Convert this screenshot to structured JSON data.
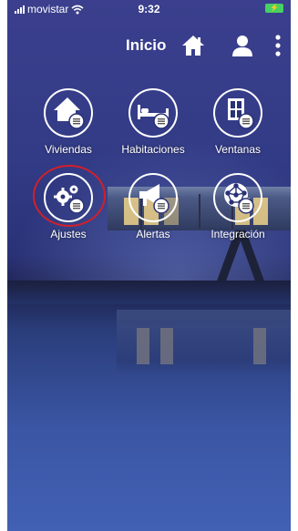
{
  "status_bar": {
    "carrier": "movistar",
    "time": "9:32",
    "battery_color": "#46d161"
  },
  "header": {
    "title": "Inicio",
    "icons": [
      "home-icon",
      "user-icon",
      "more-vertical-icon"
    ]
  },
  "tiles": [
    {
      "label": "Viviendas",
      "icon": "house-list-icon"
    },
    {
      "label": "Habitaciones",
      "icon": "bed-list-icon"
    },
    {
      "label": "Ventanas",
      "icon": "window-list-icon"
    },
    {
      "label": "Ajustes",
      "icon": "gears-list-icon",
      "highlighted": true
    },
    {
      "label": "Alertas",
      "icon": "megaphone-list-icon"
    },
    {
      "label": "Integración",
      "icon": "network-list-icon"
    }
  ],
  "colors": {
    "highlight_ring": "#d21f2a",
    "icon_stroke": "#ffffff"
  }
}
